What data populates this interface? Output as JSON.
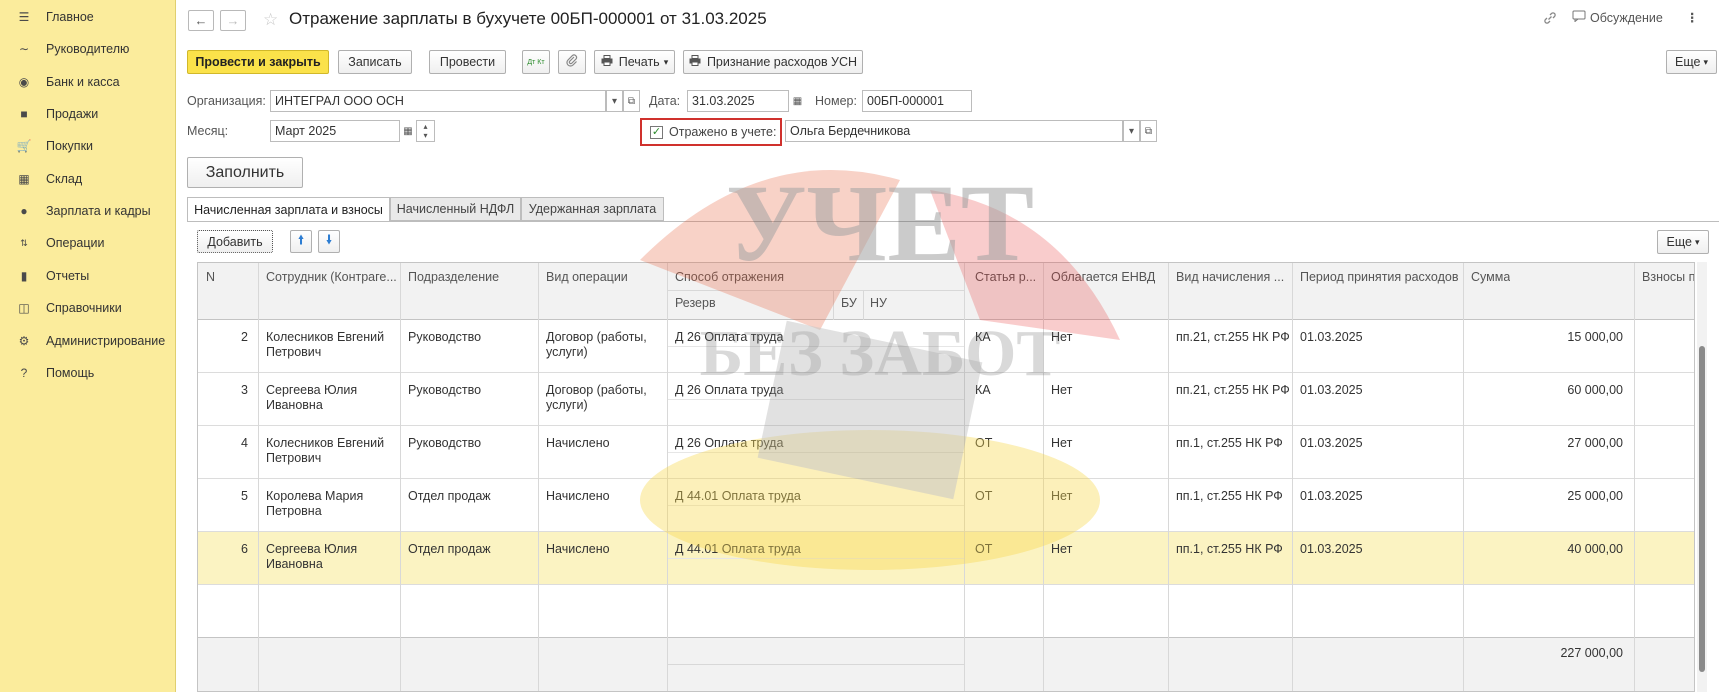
{
  "sidebar": {
    "items": [
      {
        "label": "Главное",
        "icon": "menu-icon"
      },
      {
        "label": "Руководителю",
        "icon": "trend-icon"
      },
      {
        "label": "Банк и касса",
        "icon": "coin-icon"
      },
      {
        "label": "Продажи",
        "icon": "bag-icon"
      },
      {
        "label": "Покупки",
        "icon": "cart-icon"
      },
      {
        "label": "Склад",
        "icon": "grid-icon"
      },
      {
        "label": "Зарплата и кадры",
        "icon": "person-icon"
      },
      {
        "label": "Операции",
        "icon": "dt-kt-icon"
      },
      {
        "label": "Отчеты",
        "icon": "bar-chart-icon"
      },
      {
        "label": "Справочники",
        "icon": "book-icon"
      },
      {
        "label": "Администрирование",
        "icon": "gear-icon"
      },
      {
        "label": "Помощь",
        "icon": "question-icon"
      }
    ]
  },
  "header": {
    "title": "Отражение зарплаты в бухучете 00БП-000001 от 31.03.2025",
    "discussion": "Обсуждение"
  },
  "toolbar": {
    "post_close": "Провести и закрыть",
    "save": "Записать",
    "post": "Провести",
    "dtkt": "Дт Кт",
    "print": "Печать",
    "usn": "Признание расходов УСН",
    "more": "Еще"
  },
  "form": {
    "org_label": "Организация:",
    "org_value": "ИНТЕГРАЛ ООО ОСН",
    "date_label": "Дата:",
    "date_value": "31.03.2025",
    "number_label": "Номер:",
    "number_value": "00БП-000001",
    "month_label": "Месяц:",
    "month_value": "Март 2025",
    "reflected_label": "Отражено в учете:",
    "reflected_checked": true,
    "responsible_value": "Ольга Бердечникова",
    "fill_button": "Заполнить"
  },
  "tabs": [
    {
      "label": "Начисленная зарплата и взносы",
      "active": true
    },
    {
      "label": "Начисленный НДФЛ",
      "active": false
    },
    {
      "label": "Удержанная зарплата",
      "active": false
    }
  ],
  "table_toolbar": {
    "add": "Добавить",
    "more": "Еще"
  },
  "table": {
    "columns": {
      "n": "N",
      "employee": "Сотрудник (Контраге...",
      "department": "Подразделение",
      "operation": "Вид операции",
      "method": "Способ отражения",
      "reserve": "Резерв",
      "bu": "БУ",
      "nu": "НУ",
      "article": "Статья р...",
      "envd": "Облагается ЕНВД",
      "accrual_type": "Вид начисления ...",
      "period": "Период принятия расходов",
      "sum": "Сумма",
      "contrib": "Взносы по"
    },
    "rows": [
      {
        "n": "2",
        "employee": "Колесников Евгений Петрович",
        "department": "Руководство",
        "operation": "Договор (работы, услуги)",
        "method": "Д 26 Оплата труда",
        "article": "КА",
        "envd": "Нет",
        "accrual_type": "пп.21, ст.255 НК РФ",
        "period": "01.03.2025",
        "sum": "15 000,00",
        "selected": false
      },
      {
        "n": "3",
        "employee": "Сергеева Юлия Ивановна",
        "department": "Руководство",
        "operation": "Договор (работы, услуги)",
        "method": "Д 26 Оплата труда",
        "article": "КА",
        "envd": "Нет",
        "accrual_type": "пп.21, ст.255 НК РФ",
        "period": "01.03.2025",
        "sum": "60 000,00",
        "selected": false
      },
      {
        "n": "4",
        "employee": "Колесников Евгений Петрович",
        "department": "Руководство",
        "operation": "Начислено",
        "method": "Д 26 Оплата труда",
        "article": "ОТ",
        "envd": "Нет",
        "accrual_type": "пп.1, ст.255 НК РФ",
        "period": "01.03.2025",
        "sum": "27 000,00",
        "selected": false
      },
      {
        "n": "5",
        "employee": "Королева Мария Петровна",
        "department": "Отдел продаж",
        "operation": "Начислено",
        "method": "Д 44.01 Оплата труда",
        "article": "ОТ",
        "envd": "Нет",
        "accrual_type": "пп.1, ст.255 НК РФ",
        "period": "01.03.2025",
        "sum": "25 000,00",
        "selected": false
      },
      {
        "n": "6",
        "employee": "Сергеева Юлия Ивановна",
        "department": "Отдел продаж",
        "operation": "Начислено",
        "method": "Д 44.01 Оплата труда",
        "article": "ОТ",
        "envd": "Нет",
        "accrual_type": "пп.1, ст.255 НК РФ",
        "period": "01.03.2025",
        "sum": "40 000,00",
        "selected": true
      }
    ],
    "total_sum": "227 000,00"
  },
  "watermark": {
    "line1": "УЧЕТ",
    "line2": "БЕЗ ЗАБОТ"
  },
  "colors": {
    "sidebar_bg": "#fbec9c",
    "primary_button": "#fbe24a",
    "selected_row": "#fbf3c2",
    "highlight_border": "#d0312d"
  }
}
